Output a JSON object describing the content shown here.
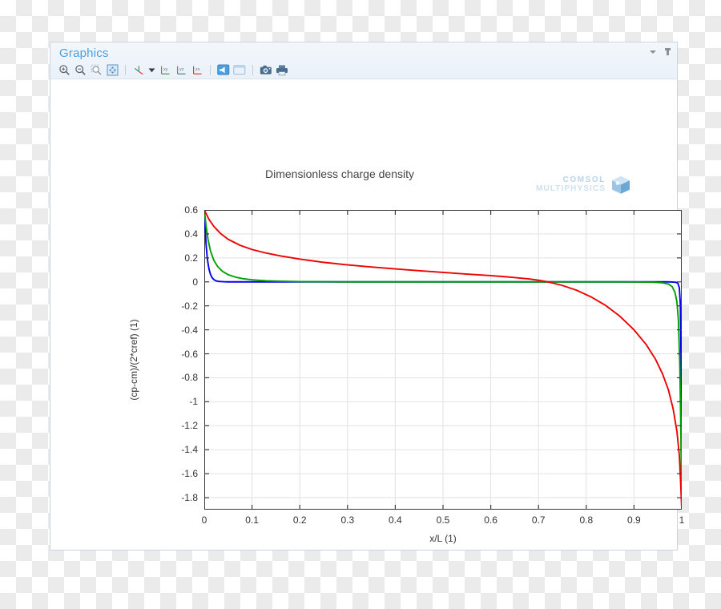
{
  "window": {
    "title": "Graphics",
    "collapse_icon": "chevron-down-icon",
    "pin_icon": "pin-icon"
  },
  "toolbar": {
    "items": [
      {
        "name": "zoom-in-icon",
        "label": "Zoom In"
      },
      {
        "name": "zoom-out-icon",
        "label": "Zoom Out"
      },
      {
        "name": "zoom-box-icon",
        "label": "Zoom Box"
      },
      {
        "name": "zoom-extents-icon",
        "label": "Zoom Extents"
      },
      {
        "name": "axis-orientation-icon",
        "label": "Go to Default View"
      },
      {
        "name": "dropdown-arrow-icon",
        "label": "View Options"
      },
      {
        "name": "view-xy-icon",
        "label": "Go to XY View"
      },
      {
        "name": "view-yz-icon",
        "label": "Go to YZ View"
      },
      {
        "name": "view-zx-icon",
        "label": "Go to ZX View"
      },
      {
        "name": "transparency-icon",
        "label": "Transparency"
      },
      {
        "name": "scene-light-icon",
        "label": "Scene Light"
      },
      {
        "name": "camera-icon",
        "label": "Image Snapshot"
      },
      {
        "name": "print-icon",
        "label": "Print"
      }
    ]
  },
  "branding": {
    "line1": "COMSOL",
    "line2": "MULTIPHYSICS",
    "cube_icon": "comsol-cube-icon"
  },
  "chart_data": {
    "type": "line",
    "title": "Dimensionless charge density",
    "xlabel": "x/L (1)",
    "ylabel": "(cp-cm)/(2*cref) (1)",
    "xlim": [
      0,
      1.0
    ],
    "ylim": [
      -1.9,
      0.6
    ],
    "grid": true,
    "legend": "none",
    "xticks": [
      "0",
      "0.1",
      "0.2",
      "0.3",
      "0.4",
      "0.5",
      "0.6",
      "0.7",
      "0.8",
      "0.9",
      "1"
    ],
    "xtick_values": [
      0,
      0.1,
      0.2,
      0.3,
      0.4,
      0.5,
      0.6,
      0.7,
      0.8,
      0.9,
      1
    ],
    "yticks": [
      "0.6",
      "0.4",
      "0.2",
      "0",
      "-0.2",
      "-0.4",
      "-0.6",
      "-0.8",
      "-1",
      "-1.2",
      "-1.4",
      "-1.6",
      "-1.8"
    ],
    "ytick_values": [
      0.6,
      0.4,
      0.2,
      0,
      -0.2,
      -0.4,
      -0.6,
      -0.8,
      -1,
      -1.2,
      -1.4,
      -1.6,
      -1.8
    ],
    "series": [
      {
        "name": "blue-curve",
        "color": "#0000ee",
        "x": [
          0,
          0.002,
          0.004,
          0.006,
          0.008,
          0.01,
          0.013,
          0.016,
          0.02,
          0.025,
          0.03,
          0.04,
          0.05,
          0.1,
          0.2,
          0.3,
          0.4,
          0.5,
          0.6,
          0.7,
          0.8,
          0.9,
          0.95,
          0.97,
          0.98,
          0.988,
          0.992,
          0.995,
          0.997,
          0.998,
          0.999,
          1.0
        ],
        "y": [
          0.6,
          0.43,
          0.3,
          0.21,
          0.15,
          0.105,
          0.062,
          0.038,
          0.019,
          0.008,
          0.004,
          0.001,
          0.0,
          0.0,
          0.0,
          0.0,
          0.0,
          0.0,
          0.0,
          0.0,
          0.0,
          0.0,
          0.0,
          0.0,
          -0.001,
          -0.004,
          -0.012,
          -0.05,
          -0.18,
          -0.42,
          -0.9,
          -1.9
        ]
      },
      {
        "name": "green-curve",
        "color": "#00a000",
        "x": [
          0,
          0.004,
          0.008,
          0.013,
          0.02,
          0.028,
          0.038,
          0.05,
          0.065,
          0.08,
          0.1,
          0.13,
          0.16,
          0.2,
          0.25,
          0.3,
          0.4,
          0.5,
          0.6,
          0.7,
          0.8,
          0.87,
          0.91,
          0.94,
          0.96,
          0.972,
          0.98,
          0.986,
          0.99,
          0.993,
          0.996,
          0.998,
          1.0
        ],
        "y": [
          0.6,
          0.46,
          0.35,
          0.258,
          0.18,
          0.128,
          0.088,
          0.06,
          0.04,
          0.027,
          0.017,
          0.009,
          0.005,
          0.002,
          0.001,
          0.0,
          0.0,
          0.0,
          0.0,
          0.0,
          0.0,
          0.0,
          -0.001,
          -0.003,
          -0.008,
          -0.018,
          -0.04,
          -0.09,
          -0.17,
          -0.32,
          -0.7,
          -1.2,
          -1.9
        ]
      },
      {
        "name": "red-curve",
        "color": "#ee0000",
        "x": [
          0,
          0.01,
          0.02,
          0.035,
          0.05,
          0.075,
          0.1,
          0.13,
          0.16,
          0.2,
          0.25,
          0.3,
          0.35,
          0.4,
          0.45,
          0.5,
          0.55,
          0.6,
          0.64,
          0.68,
          0.7,
          0.72,
          0.75,
          0.78,
          0.81,
          0.84,
          0.87,
          0.9,
          0.925,
          0.945,
          0.96,
          0.972,
          0.982,
          0.99,
          0.995,
          0.998,
          1.0
        ],
        "y": [
          0.6,
          0.52,
          0.463,
          0.4,
          0.355,
          0.305,
          0.27,
          0.24,
          0.216,
          0.19,
          0.163,
          0.142,
          0.124,
          0.108,
          0.093,
          0.079,
          0.065,
          0.052,
          0.04,
          0.025,
          0.014,
          0.0,
          -0.03,
          -0.07,
          -0.125,
          -0.195,
          -0.285,
          -0.4,
          -0.52,
          -0.645,
          -0.77,
          -0.9,
          -1.06,
          -1.25,
          -1.45,
          -1.7,
          -1.9
        ]
      }
    ]
  }
}
